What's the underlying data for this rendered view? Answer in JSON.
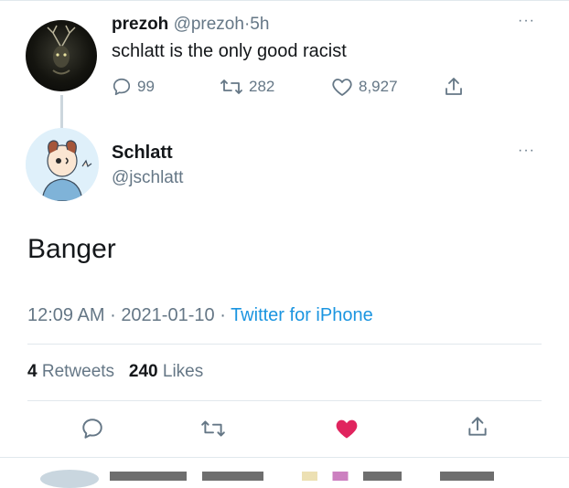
{
  "parent": {
    "display_name": "prezoh",
    "handle": "@prezoh",
    "separator": "·",
    "time": "5h",
    "text": "schlatt is the only good racist",
    "replies": "99",
    "retweets": "282",
    "likes": "8,927",
    "more": "···"
  },
  "main": {
    "display_name": "Schlatt",
    "handle": "@jschlatt",
    "more": "···",
    "text": "Banger",
    "time": "12:09 AM",
    "date": "2021-01-10",
    "sep1": "·",
    "sep2": "·",
    "source": "Twitter for iPhone",
    "retweets_count": "4",
    "retweets_label": "Retweets",
    "likes_count": "240",
    "likes_label": "Likes"
  },
  "icons": {
    "reply": "reply-icon",
    "retweet": "retweet-icon",
    "like": "heart-icon",
    "share": "share-icon",
    "liked_color": "#e0245e",
    "link_color": "#1b95e0"
  }
}
